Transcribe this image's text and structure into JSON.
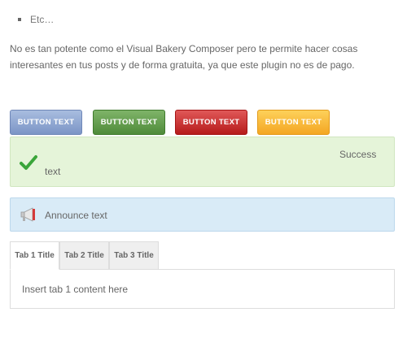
{
  "list": {
    "items": [
      "Etc…"
    ]
  },
  "paragraph": "No es tan potente como el Visual Bakery Composer pero te permite hacer cosas interesantes en tus posts y de forma gratuita, ya que este plugin no es de pago.",
  "buttons": [
    {
      "label": "BUTTON TEXT",
      "color": "#7c95c6"
    },
    {
      "label": "BUTTON TEXT",
      "color": "#4f8b3a"
    },
    {
      "label": "BUTTON TEXT",
      "color": "#b61b1b"
    },
    {
      "label": "BUTTON TEXT",
      "color": "#f4a623"
    }
  ],
  "success_box": {
    "line1": "Success",
    "line2": "text",
    "icon": "checkmark-icon",
    "bg": "#e5f4d9"
  },
  "announce_box": {
    "text": "Announce text",
    "icon": "megaphone-icon",
    "bg": "#d9ebf7"
  },
  "tabs": [
    {
      "label": "Tab 1 Title",
      "active": true
    },
    {
      "label": "Tab 2 Title",
      "active": false
    },
    {
      "label": "Tab 3 Title",
      "active": false
    }
  ],
  "tab_content": "Insert tab 1 content here"
}
